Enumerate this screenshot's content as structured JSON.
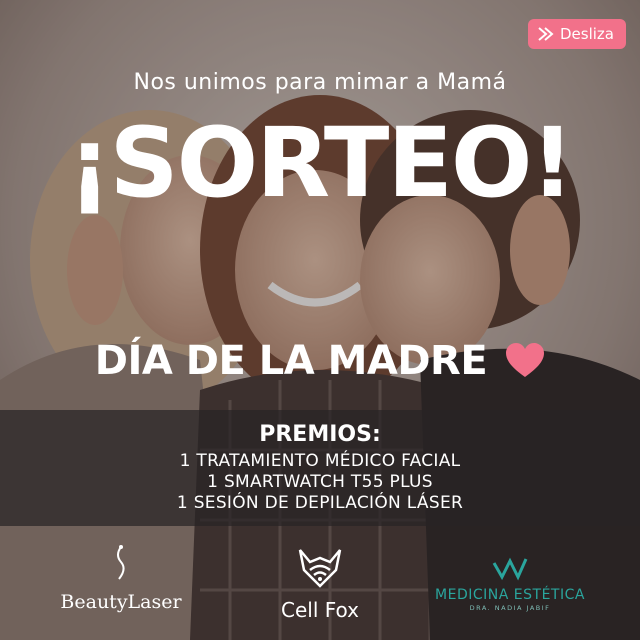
{
  "colors": {
    "accent": "#f2718a",
    "teal": "#2aa59d",
    "text": "#ffffff"
  },
  "swipe": {
    "label": "Desliza",
    "icon": "arrow-right-icon"
  },
  "header": {
    "subtitle": "Nos unimos para mimar a Mamá",
    "title": "¡SORTEO!"
  },
  "occasion": {
    "label": "DÍA DE LA MADRE",
    "icon": "heart-icon"
  },
  "prizes": {
    "title": "PREMIOS:",
    "items": [
      "1 TRATAMIENTO MÉDICO FACIAL",
      "1 SMARTWATCH T55 PLUS",
      "1 SESIÓN DE DEPILACIÓN LÁSER"
    ]
  },
  "sponsors": {
    "beauty": {
      "name": "BeautyLaser",
      "icon": "beautylaser-logo-icon"
    },
    "cell": {
      "name": "Cell Fox",
      "icon": "fox-logo-icon"
    },
    "medicina": {
      "name": "MEDICINA ESTÉTICA",
      "sub": "DRA. NADIA JABIF",
      "icon": "medicina-logo-icon"
    }
  }
}
